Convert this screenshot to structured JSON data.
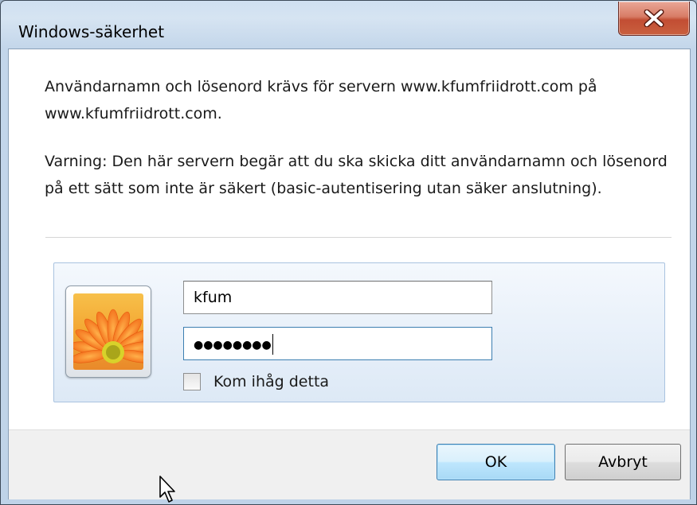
{
  "window": {
    "title": "Windows-säkerhet",
    "close_icon": "close-icon"
  },
  "message": {
    "line1": "Användarnamn och lösenord krävs för servern www.kfumfriidrott.com på www.kfumfriidrott.com.",
    "warning": "Varning: Den här servern begär att du ska skicka ditt användarnamn och lösenord på ett sätt som inte är säkert (basic-autentisering utan säker anslutning)."
  },
  "credentials": {
    "avatar_icon": "user-avatar-flower-icon",
    "username": "kfum",
    "password_masked": "●●●●●●●●",
    "remember_label": "Kom ihåg detta",
    "remember_checked": false
  },
  "buttons": {
    "ok_label": "OK",
    "cancel_label": "Avbryt"
  },
  "colors": {
    "close_button": "#c9603f",
    "ok_button_border": "#3c7fb1",
    "panel_background": "#dde9f6"
  }
}
